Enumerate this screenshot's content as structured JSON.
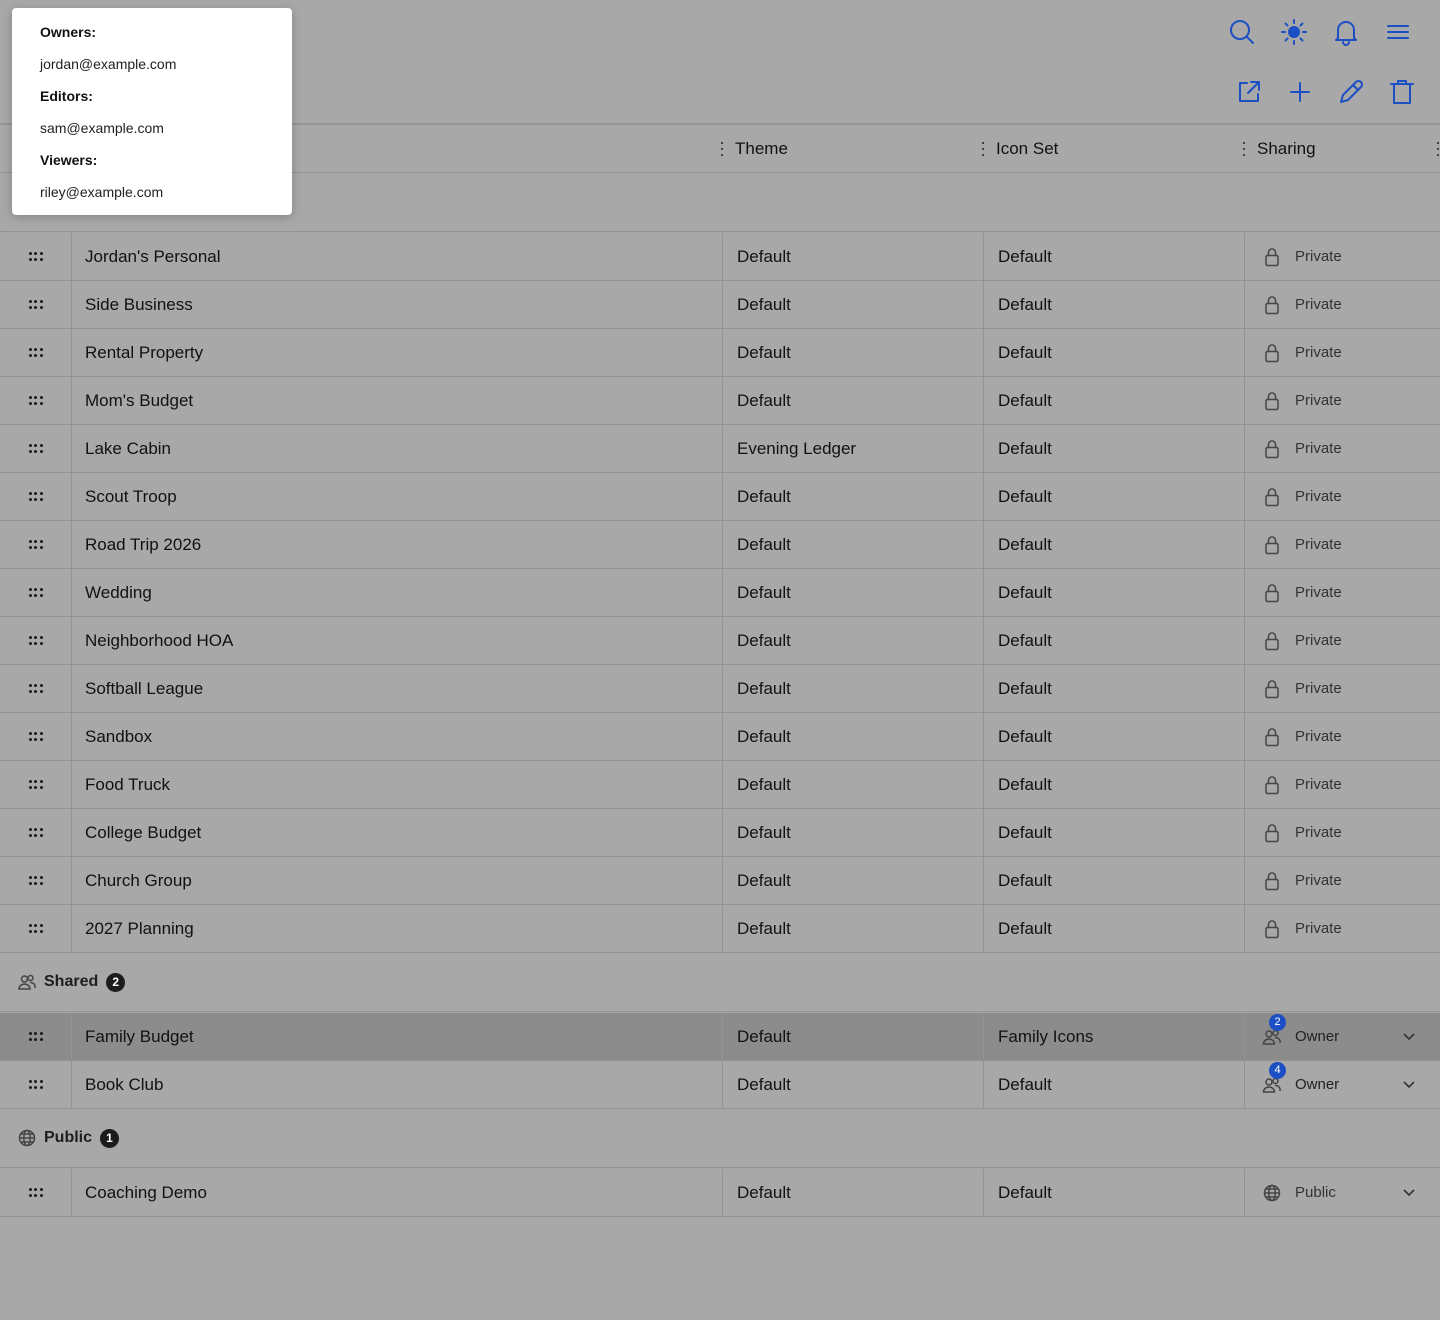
{
  "colors": {
    "accent": "#1d4fc4",
    "backdrop": "#a8a8a8",
    "selected_row": "#8c8c8c"
  },
  "topbar": {
    "icons": [
      "search-icon",
      "brightness-icon",
      "bell-icon",
      "menu-icon"
    ]
  },
  "toolbar": {
    "icons": [
      "open-external-icon",
      "plus-icon",
      "pencil-icon",
      "trash-icon"
    ]
  },
  "columns": {
    "theme": "Theme",
    "icon_set": "Icon Set",
    "sharing": "Sharing"
  },
  "groups": {
    "shared": {
      "label": "Shared",
      "count": "2",
      "icon": "people-icon"
    },
    "public": {
      "label": "Public",
      "count": "1",
      "icon": "globe-icon"
    }
  },
  "private_rows": [
    {
      "name": "Jordan's Personal",
      "theme": "Default",
      "icon_set": "Default",
      "sharing": "Private"
    },
    {
      "name": "Side Business",
      "theme": "Default",
      "icon_set": "Default",
      "sharing": "Private"
    },
    {
      "name": "Rental Property",
      "theme": "Default",
      "icon_set": "Default",
      "sharing": "Private"
    },
    {
      "name": "Mom's Budget",
      "theme": "Default",
      "icon_set": "Default",
      "sharing": "Private"
    },
    {
      "name": "Lake Cabin",
      "theme": "Evening Ledger",
      "icon_set": "Default",
      "sharing": "Private"
    },
    {
      "name": "Scout Troop",
      "theme": "Default",
      "icon_set": "Default",
      "sharing": "Private"
    },
    {
      "name": "Road Trip 2026",
      "theme": "Default",
      "icon_set": "Default",
      "sharing": "Private"
    },
    {
      "name": "Wedding",
      "theme": "Default",
      "icon_set": "Default",
      "sharing": "Private"
    },
    {
      "name": "Neighborhood HOA",
      "theme": "Default",
      "icon_set": "Default",
      "sharing": "Private"
    },
    {
      "name": "Softball League",
      "theme": "Default",
      "icon_set": "Default",
      "sharing": "Private"
    },
    {
      "name": "Sandbox",
      "theme": "Default",
      "icon_set": "Default",
      "sharing": "Private"
    },
    {
      "name": "Food Truck",
      "theme": "Default",
      "icon_set": "Default",
      "sharing": "Private"
    },
    {
      "name": "College Budget",
      "theme": "Default",
      "icon_set": "Default",
      "sharing": "Private"
    },
    {
      "name": "Church Group",
      "theme": "Default",
      "icon_set": "Default",
      "sharing": "Private"
    },
    {
      "name": "2027 Planning",
      "theme": "Default",
      "icon_set": "Default",
      "sharing": "Private"
    }
  ],
  "shared_rows": [
    {
      "name": "Family Budget",
      "theme": "Default",
      "icon_set": "Family Icons",
      "sharing": "Owner",
      "member_count": "2",
      "selected": true
    },
    {
      "name": "Book Club",
      "theme": "Default",
      "icon_set": "Default",
      "sharing": "Owner",
      "member_count": "4",
      "selected": false
    }
  ],
  "public_rows": [
    {
      "name": "Coaching Demo",
      "theme": "Default",
      "icon_set": "Default",
      "sharing": "Public"
    }
  ],
  "popover": {
    "owners_label": "Owners:",
    "owners": [
      "jordan@example.com"
    ],
    "editors_label": "Editors:",
    "editors": [
      "sam@example.com"
    ],
    "viewers_label": "Viewers:",
    "viewers": [
      "riley@example.com"
    ]
  }
}
